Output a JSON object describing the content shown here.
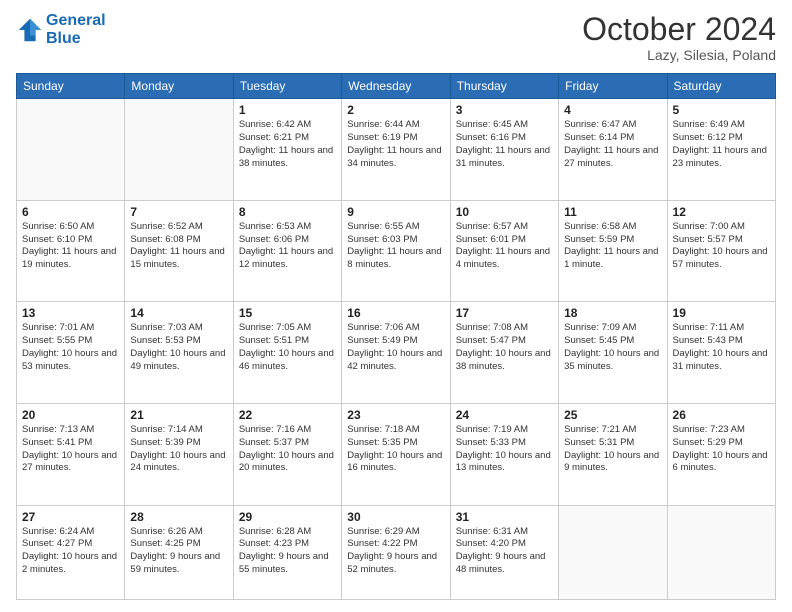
{
  "header": {
    "logo_line1": "General",
    "logo_line2": "Blue",
    "month_title": "October 2024",
    "location": "Lazy, Silesia, Poland"
  },
  "weekdays": [
    "Sunday",
    "Monday",
    "Tuesday",
    "Wednesday",
    "Thursday",
    "Friday",
    "Saturday"
  ],
  "weeks": [
    [
      {
        "day": "",
        "info": ""
      },
      {
        "day": "",
        "info": ""
      },
      {
        "day": "1",
        "info": "Sunrise: 6:42 AM\nSunset: 6:21 PM\nDaylight: 11 hours and 38 minutes."
      },
      {
        "day": "2",
        "info": "Sunrise: 6:44 AM\nSunset: 6:19 PM\nDaylight: 11 hours and 34 minutes."
      },
      {
        "day": "3",
        "info": "Sunrise: 6:45 AM\nSunset: 6:16 PM\nDaylight: 11 hours and 31 minutes."
      },
      {
        "day": "4",
        "info": "Sunrise: 6:47 AM\nSunset: 6:14 PM\nDaylight: 11 hours and 27 minutes."
      },
      {
        "day": "5",
        "info": "Sunrise: 6:49 AM\nSunset: 6:12 PM\nDaylight: 11 hours and 23 minutes."
      }
    ],
    [
      {
        "day": "6",
        "info": "Sunrise: 6:50 AM\nSunset: 6:10 PM\nDaylight: 11 hours and 19 minutes."
      },
      {
        "day": "7",
        "info": "Sunrise: 6:52 AM\nSunset: 6:08 PM\nDaylight: 11 hours and 15 minutes."
      },
      {
        "day": "8",
        "info": "Sunrise: 6:53 AM\nSunset: 6:06 PM\nDaylight: 11 hours and 12 minutes."
      },
      {
        "day": "9",
        "info": "Sunrise: 6:55 AM\nSunset: 6:03 PM\nDaylight: 11 hours and 8 minutes."
      },
      {
        "day": "10",
        "info": "Sunrise: 6:57 AM\nSunset: 6:01 PM\nDaylight: 11 hours and 4 minutes."
      },
      {
        "day": "11",
        "info": "Sunrise: 6:58 AM\nSunset: 5:59 PM\nDaylight: 11 hours and 1 minute."
      },
      {
        "day": "12",
        "info": "Sunrise: 7:00 AM\nSunset: 5:57 PM\nDaylight: 10 hours and 57 minutes."
      }
    ],
    [
      {
        "day": "13",
        "info": "Sunrise: 7:01 AM\nSunset: 5:55 PM\nDaylight: 10 hours and 53 minutes."
      },
      {
        "day": "14",
        "info": "Sunrise: 7:03 AM\nSunset: 5:53 PM\nDaylight: 10 hours and 49 minutes."
      },
      {
        "day": "15",
        "info": "Sunrise: 7:05 AM\nSunset: 5:51 PM\nDaylight: 10 hours and 46 minutes."
      },
      {
        "day": "16",
        "info": "Sunrise: 7:06 AM\nSunset: 5:49 PM\nDaylight: 10 hours and 42 minutes."
      },
      {
        "day": "17",
        "info": "Sunrise: 7:08 AM\nSunset: 5:47 PM\nDaylight: 10 hours and 38 minutes."
      },
      {
        "day": "18",
        "info": "Sunrise: 7:09 AM\nSunset: 5:45 PM\nDaylight: 10 hours and 35 minutes."
      },
      {
        "day": "19",
        "info": "Sunrise: 7:11 AM\nSunset: 5:43 PM\nDaylight: 10 hours and 31 minutes."
      }
    ],
    [
      {
        "day": "20",
        "info": "Sunrise: 7:13 AM\nSunset: 5:41 PM\nDaylight: 10 hours and 27 minutes."
      },
      {
        "day": "21",
        "info": "Sunrise: 7:14 AM\nSunset: 5:39 PM\nDaylight: 10 hours and 24 minutes."
      },
      {
        "day": "22",
        "info": "Sunrise: 7:16 AM\nSunset: 5:37 PM\nDaylight: 10 hours and 20 minutes."
      },
      {
        "day": "23",
        "info": "Sunrise: 7:18 AM\nSunset: 5:35 PM\nDaylight: 10 hours and 16 minutes."
      },
      {
        "day": "24",
        "info": "Sunrise: 7:19 AM\nSunset: 5:33 PM\nDaylight: 10 hours and 13 minutes."
      },
      {
        "day": "25",
        "info": "Sunrise: 7:21 AM\nSunset: 5:31 PM\nDaylight: 10 hours and 9 minutes."
      },
      {
        "day": "26",
        "info": "Sunrise: 7:23 AM\nSunset: 5:29 PM\nDaylight: 10 hours and 6 minutes."
      }
    ],
    [
      {
        "day": "27",
        "info": "Sunrise: 6:24 AM\nSunset: 4:27 PM\nDaylight: 10 hours and 2 minutes."
      },
      {
        "day": "28",
        "info": "Sunrise: 6:26 AM\nSunset: 4:25 PM\nDaylight: 9 hours and 59 minutes."
      },
      {
        "day": "29",
        "info": "Sunrise: 6:28 AM\nSunset: 4:23 PM\nDaylight: 9 hours and 55 minutes."
      },
      {
        "day": "30",
        "info": "Sunrise: 6:29 AM\nSunset: 4:22 PM\nDaylight: 9 hours and 52 minutes."
      },
      {
        "day": "31",
        "info": "Sunrise: 6:31 AM\nSunset: 4:20 PM\nDaylight: 9 hours and 48 minutes."
      },
      {
        "day": "",
        "info": ""
      },
      {
        "day": "",
        "info": ""
      }
    ]
  ]
}
